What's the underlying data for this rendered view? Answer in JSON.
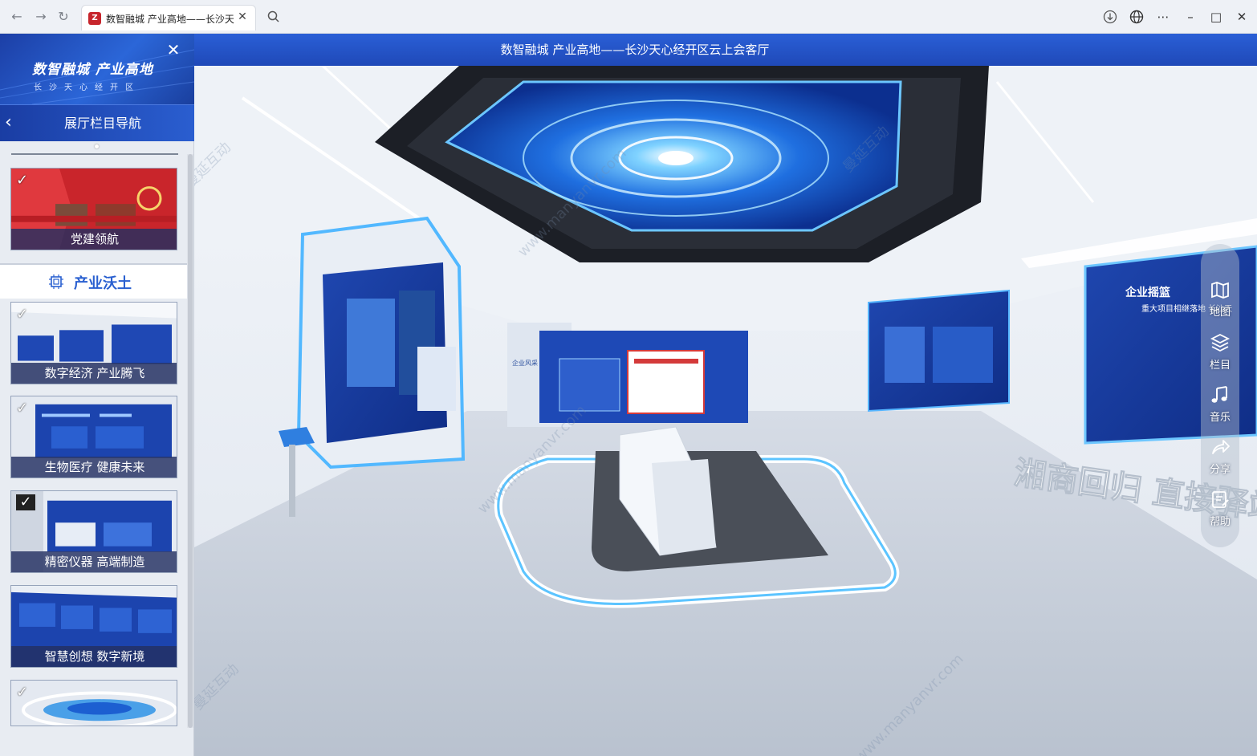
{
  "browser": {
    "tab_title": "数智融城 产业高地——长沙天心经开区云上会客厅",
    "favicon_letter": "Z"
  },
  "app": {
    "title": "数智融城 产业高地——长沙天心经开区云上会客厅"
  },
  "sidebar": {
    "brand_title": "数智融城 产业高地",
    "brand_subtitle": "长沙天心经开区",
    "nav_title": "展厅栏目导航",
    "section_title": "产业沃土",
    "cards_top": [
      {
        "label": "党建领航",
        "checked": true
      }
    ],
    "cards": [
      {
        "label": "数字经济 产业腾飞",
        "checked": true
      },
      {
        "label": "生物医疗 健康未来",
        "checked": true
      },
      {
        "label": "精密仪器 高端制造",
        "checked": true
      },
      {
        "label": "智慧创想 数字新境",
        "checked": false
      },
      {
        "label": "",
        "checked": true
      }
    ]
  },
  "scene": {
    "wall_banner_right": "企业摇篮",
    "wall_sub_right": "重大项目相继落地 长沙天",
    "floor_slogan": "湘商回归 直接驿站",
    "center_sign": "企业风采",
    "watermark_cn": "曼延互动",
    "watermark_en": "www.manyanvr.com"
  },
  "toolbar": {
    "items": [
      {
        "label": "地图",
        "icon": "map-icon"
      },
      {
        "label": "栏目",
        "icon": "layers-icon"
      },
      {
        "label": "音乐",
        "icon": "music-icon"
      },
      {
        "label": "分享",
        "icon": "share-icon"
      },
      {
        "label": "帮助",
        "icon": "help-icon"
      }
    ]
  }
}
